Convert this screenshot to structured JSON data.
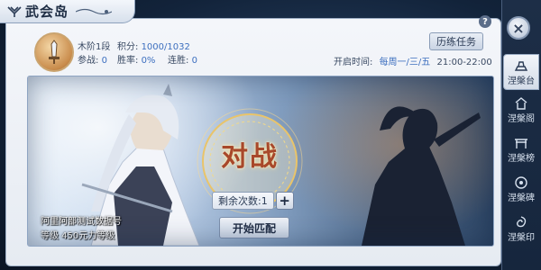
{
  "window": {
    "title": "武会岛"
  },
  "player": {
    "rank_label": "木阶1段",
    "score_label": "积分:",
    "score_value": "1000/1032",
    "wins_label": "参战:",
    "wins_value": "0",
    "winrate_label": "胜率:",
    "winrate_value": "0%",
    "streak_label": "连胜:",
    "streak_value": "0"
  },
  "header": {
    "task_button": "历练任务",
    "open_time_label": "开启时间:",
    "open_days": "每周一/三/五",
    "open_hours": "21:00-22:00",
    "help": "?"
  },
  "battle": {
    "vs_text": "对战",
    "remaining_label": "剩余次数:",
    "remaining_value": "1",
    "plus": "+",
    "match_button": "开始匹配",
    "opponent_name": "阿里阿部测试数据号",
    "opponent_level": "等级 450元力等级"
  },
  "sidebar": {
    "close": "×",
    "tabs": [
      {
        "label": "涅槃台",
        "icon": "platform-icon",
        "active": true
      },
      {
        "label": "涅槃阁",
        "icon": "pavilion-icon",
        "active": false
      },
      {
        "label": "涅槃榜",
        "icon": "ranking-gate-icon",
        "active": false
      },
      {
        "label": "涅槃碑",
        "icon": "stele-icon",
        "active": false
      },
      {
        "label": "涅槃印",
        "icon": "seal-icon",
        "active": false
      }
    ]
  },
  "colors": {
    "accent_blue": "#3d6fbf",
    "vs_red": "#a8482a",
    "panel_bg": "#eef2f8",
    "sidebar_bg": "#1d2e47"
  }
}
